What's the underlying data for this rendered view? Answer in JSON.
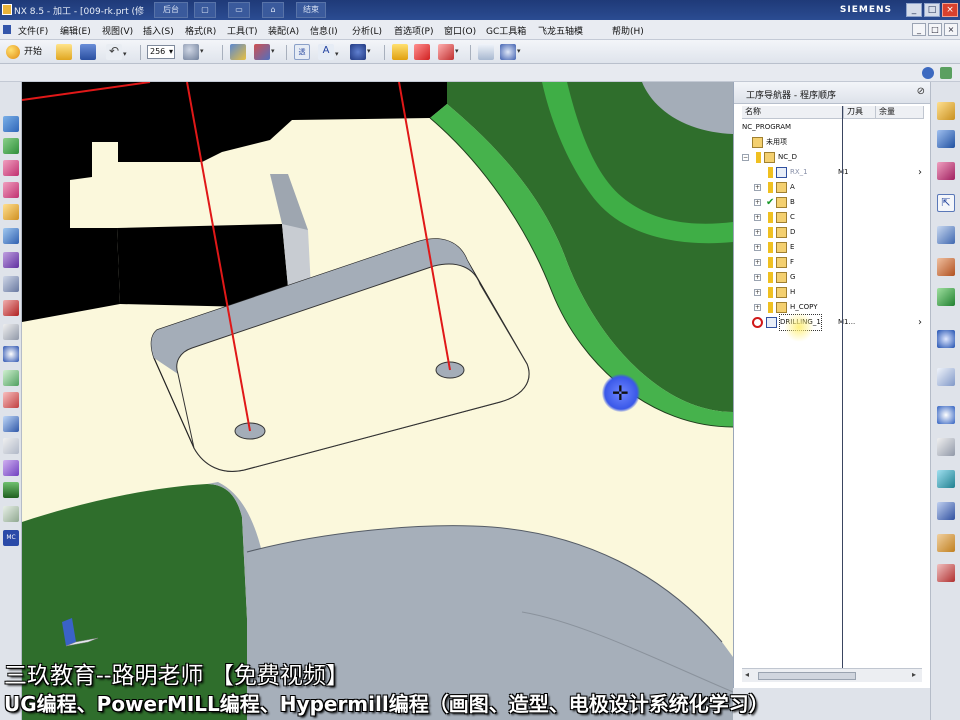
{
  "titlebar": {
    "title": "NX 8.5 - 加工 - [009-rk.prt (修",
    "quick_access": [
      "后台",
      "",
      "",
      "",
      "结束"
    ],
    "brand": "SIEMENS",
    "win_buttons": [
      "_",
      "□",
      "×"
    ]
  },
  "menubar": {
    "items": [
      "文件(F)",
      "编辑(E)",
      "视图(V)",
      "插入(S)",
      "格式(R)",
      "工具(T)",
      "装配(A)",
      "信息(I)",
      "分析(L)",
      "首选项(P)",
      "窗口(O)",
      "GC工具箱",
      "飞龙五轴模",
      "帮助(H)"
    ],
    "mdi_buttons": [
      "_",
      "□",
      "×"
    ]
  },
  "toolbar": {
    "start_label": "开始",
    "color_combo": "256"
  },
  "navigator": {
    "title": "工序导航器 - 程序顺序",
    "pin_icon": "pin-icon",
    "columns": [
      "名称",
      "刀具",
      "余量"
    ],
    "rows": [
      {
        "label": "NC_PROGRAM",
        "tool": "",
        "level": 0,
        "icon": "none",
        "expander": ""
      },
      {
        "label": "未用项",
        "tool": "",
        "level": 1,
        "icon": "folder",
        "expander": ""
      },
      {
        "label": "NC_D",
        "tool": "",
        "level": 1,
        "icon": "program",
        "expander": "−"
      },
      {
        "label": "RX_1",
        "tool": "M1",
        "level": 2,
        "icon": "operation",
        "expander": "",
        "muted": true
      },
      {
        "label": "A",
        "tool": "",
        "level": 2,
        "icon": "program",
        "expander": "+"
      },
      {
        "label": "B",
        "tool": "",
        "level": 2,
        "icon": "program-ok",
        "expander": "+"
      },
      {
        "label": "C",
        "tool": "",
        "level": 2,
        "icon": "program",
        "expander": "+"
      },
      {
        "label": "D",
        "tool": "",
        "level": 2,
        "icon": "program",
        "expander": "+"
      },
      {
        "label": "E",
        "tool": "",
        "level": 2,
        "icon": "program",
        "expander": "+"
      },
      {
        "label": "F",
        "tool": "",
        "level": 2,
        "icon": "program",
        "expander": "+"
      },
      {
        "label": "G",
        "tool": "",
        "level": 2,
        "icon": "program",
        "expander": "+"
      },
      {
        "label": "H",
        "tool": "",
        "level": 2,
        "icon": "program",
        "expander": "+"
      },
      {
        "label": "H_COPY",
        "tool": "",
        "level": 2,
        "icon": "program",
        "expander": "+"
      },
      {
        "label": "DRILLING_1",
        "tool": "M1...",
        "level": 2,
        "icon": "drill-error",
        "expander": "",
        "selected": true
      }
    ]
  },
  "captions": {
    "line1": "三玖教育--路明老师  【免费视频】",
    "line2": "UG编程、PowerMILL编程、Hypermill编程（画图、造型、电极设计系统化学习）"
  },
  "colors": {
    "title_bar": "#2b4c92",
    "face_cream": "#fbf8dc",
    "face_green": "#3fae46",
    "face_dark_green": "#2f6e2c",
    "wall_gray": "#a4adb8",
    "tool_axis_red": "#e01818"
  }
}
